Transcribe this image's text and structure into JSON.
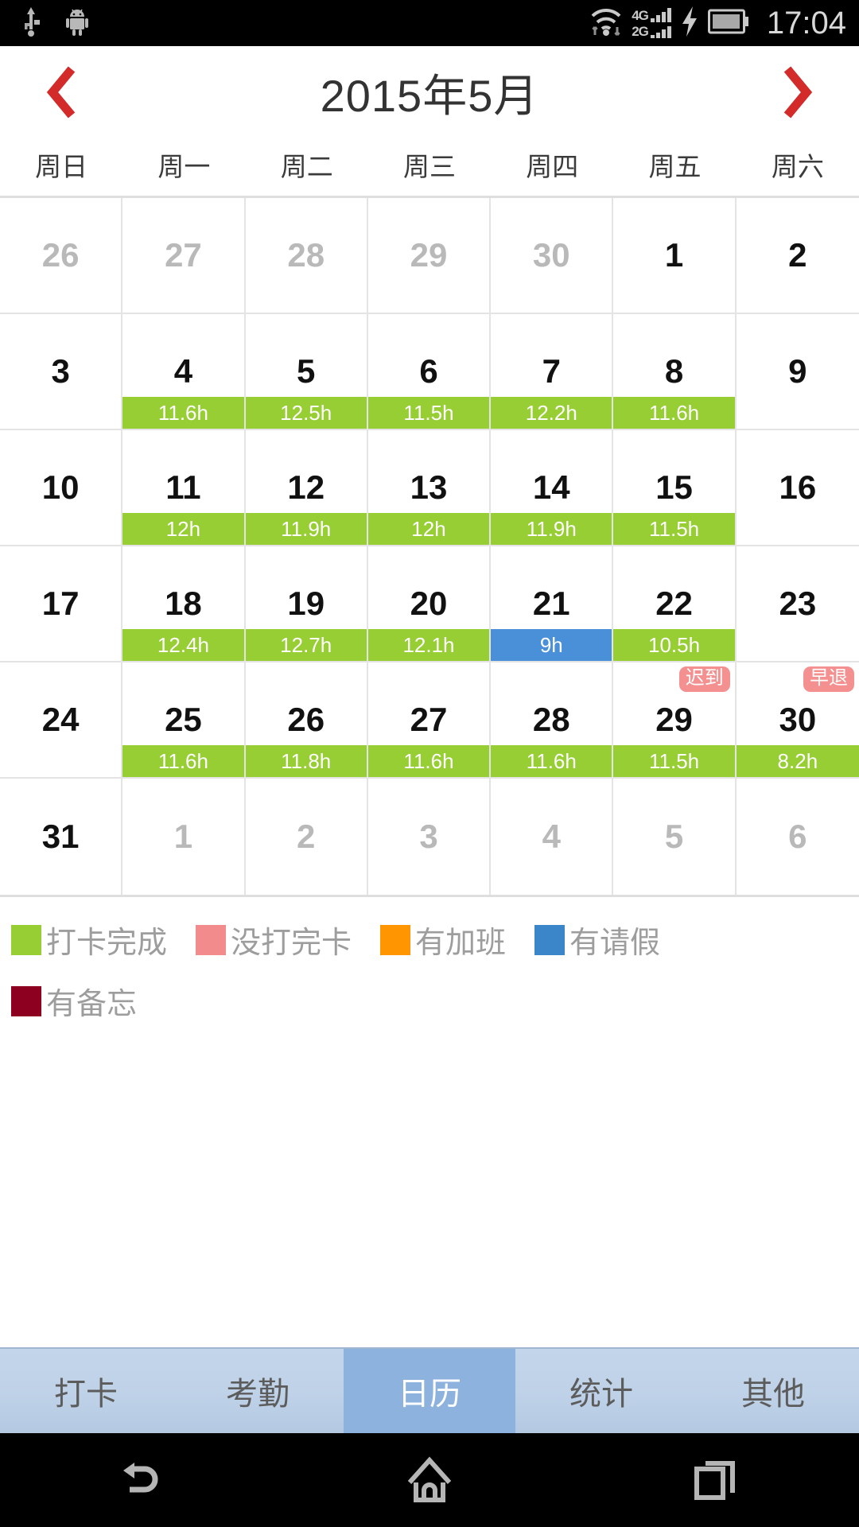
{
  "status_bar": {
    "icons": [
      "usb-icon",
      "android-robot-icon",
      "wifi-icon",
      "signal-4g-icon",
      "signal-2g-icon",
      "charging-bolt-icon",
      "battery-icon"
    ],
    "net_label_1": "4G",
    "net_label_2": "2G",
    "clock": "17:04"
  },
  "header": {
    "prev_label": "‹",
    "title": "2015年5月",
    "next_label": "›"
  },
  "weekdays": [
    "周日",
    "周一",
    "周二",
    "周三",
    "周四",
    "周五",
    "周六"
  ],
  "calendar": {
    "year": 2015,
    "month": 5,
    "cells": [
      {
        "day": "26",
        "other": true
      },
      {
        "day": "27",
        "other": true
      },
      {
        "day": "28",
        "other": true
      },
      {
        "day": "29",
        "other": true
      },
      {
        "day": "30",
        "other": true
      },
      {
        "day": "1",
        "other": false
      },
      {
        "day": "2",
        "other": false
      },
      {
        "day": "3",
        "other": false
      },
      {
        "day": "4",
        "other": false,
        "bar": "11.6h",
        "bar_color": "green"
      },
      {
        "day": "5",
        "other": false,
        "bar": "12.5h",
        "bar_color": "green"
      },
      {
        "day": "6",
        "other": false,
        "bar": "11.5h",
        "bar_color": "green"
      },
      {
        "day": "7",
        "other": false,
        "bar": "12.2h",
        "bar_color": "green"
      },
      {
        "day": "8",
        "other": false,
        "bar": "11.6h",
        "bar_color": "green"
      },
      {
        "day": "9",
        "other": false
      },
      {
        "day": "10",
        "other": false
      },
      {
        "day": "11",
        "other": false,
        "bar": "12h",
        "bar_color": "green"
      },
      {
        "day": "12",
        "other": false,
        "bar": "11.9h",
        "bar_color": "green"
      },
      {
        "day": "13",
        "other": false,
        "bar": "12h",
        "bar_color": "green"
      },
      {
        "day": "14",
        "other": false,
        "bar": "11.9h",
        "bar_color": "green"
      },
      {
        "day": "15",
        "other": false,
        "bar": "11.5h",
        "bar_color": "green"
      },
      {
        "day": "16",
        "other": false
      },
      {
        "day": "17",
        "other": false
      },
      {
        "day": "18",
        "other": false,
        "bar": "12.4h",
        "bar_color": "green"
      },
      {
        "day": "19",
        "other": false,
        "bar": "12.7h",
        "bar_color": "green"
      },
      {
        "day": "20",
        "other": false,
        "bar": "12.1h",
        "bar_color": "green"
      },
      {
        "day": "21",
        "other": false,
        "bar": "9h",
        "bar_color": "blue"
      },
      {
        "day": "22",
        "other": false,
        "bar": "10.5h",
        "bar_color": "green"
      },
      {
        "day": "23",
        "other": false
      },
      {
        "day": "24",
        "other": false
      },
      {
        "day": "25",
        "other": false,
        "bar": "11.6h",
        "bar_color": "green"
      },
      {
        "day": "26",
        "other": false,
        "bar": "11.8h",
        "bar_color": "green"
      },
      {
        "day": "27",
        "other": false,
        "bar": "11.6h",
        "bar_color": "green"
      },
      {
        "day": "28",
        "other": false,
        "bar": "11.6h",
        "bar_color": "green"
      },
      {
        "day": "29",
        "other": false,
        "bar": "11.5h",
        "bar_color": "green",
        "badge": "迟到"
      },
      {
        "day": "30",
        "other": false,
        "bar": "8.2h",
        "bar_color": "green",
        "badge": "早退"
      },
      {
        "day": "31",
        "other": false
      },
      {
        "day": "1",
        "other": true
      },
      {
        "day": "2",
        "other": true
      },
      {
        "day": "3",
        "other": true
      },
      {
        "day": "4",
        "other": true
      },
      {
        "day": "5",
        "other": true
      },
      {
        "day": "6",
        "other": true
      }
    ]
  },
  "legend": {
    "row1": [
      {
        "label": "打卡完成",
        "color": "#97ce34"
      },
      {
        "label": "没打完卡",
        "color": "#f28b8b"
      },
      {
        "label": "有加班",
        "color": "#ff9500"
      },
      {
        "label": "有请假",
        "color": "#3b86c8"
      }
    ],
    "row2": [
      {
        "label": "有备忘",
        "color": "#8e0020"
      }
    ]
  },
  "tabs": [
    {
      "label": "打卡",
      "active": false
    },
    {
      "label": "考勤",
      "active": false
    },
    {
      "label": "日历",
      "active": true
    },
    {
      "label": "统计",
      "active": false
    },
    {
      "label": "其他",
      "active": false
    }
  ],
  "nav_bar": {
    "back": "back-icon",
    "home": "home-icon",
    "recents": "recents-icon"
  },
  "colors": {
    "accent_red": "#d32a2a",
    "bar_green": "#97ce34",
    "bar_blue": "#4a90d9",
    "badge_pink": "#f49090",
    "tab_active": "#8cb2dd"
  }
}
